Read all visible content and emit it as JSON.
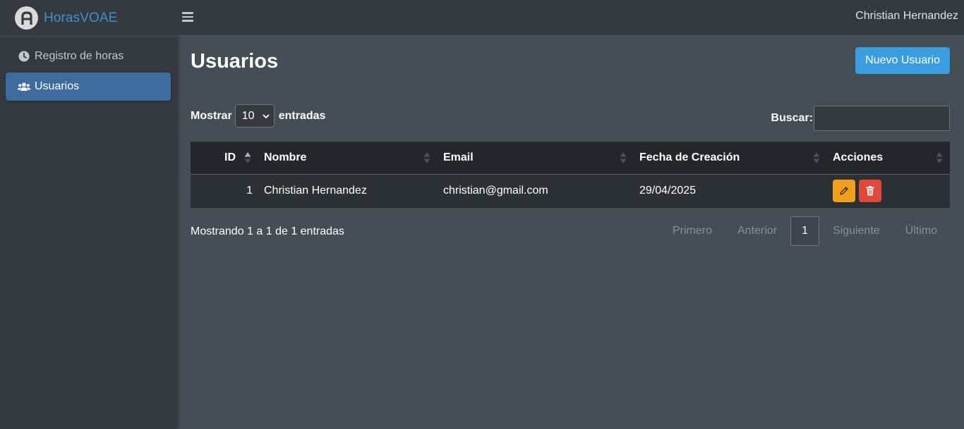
{
  "brand": {
    "name_bold": "Horas",
    "name_light": "VOAE"
  },
  "sidebar": {
    "items": [
      {
        "label": "Registro de horas",
        "icon": "clock-icon"
      },
      {
        "label": "Usuarios",
        "icon": "users-icon",
        "active": true
      }
    ]
  },
  "topbar": {
    "user_name": "Christian Hernandez"
  },
  "page": {
    "title": "Usuarios",
    "new_button": "Nuevo Usuario"
  },
  "controls": {
    "show_label": "Mostrar",
    "page_length": "10",
    "entries_label": "entradas",
    "search_label": "Buscar:",
    "search_value": ""
  },
  "table": {
    "columns": [
      "ID",
      "Nombre",
      "Email",
      "Fecha de Creación",
      "Acciones"
    ],
    "rows": [
      {
        "id": "1",
        "name": "Christian Hernandez",
        "email": "christian@gmail.com",
        "created": "29/04/2025"
      }
    ]
  },
  "footer": {
    "info": "Mostrando 1 a 1 de 1 entradas",
    "pagination": {
      "first": "Primero",
      "prev": "Anterior",
      "current": "1",
      "next": "Siguiente",
      "last": "Último"
    }
  },
  "colors": {
    "accent": "#3a9de0",
    "edit": "#f0a01a",
    "delete": "#e0483a",
    "active_nav": "#3e6b9d"
  }
}
